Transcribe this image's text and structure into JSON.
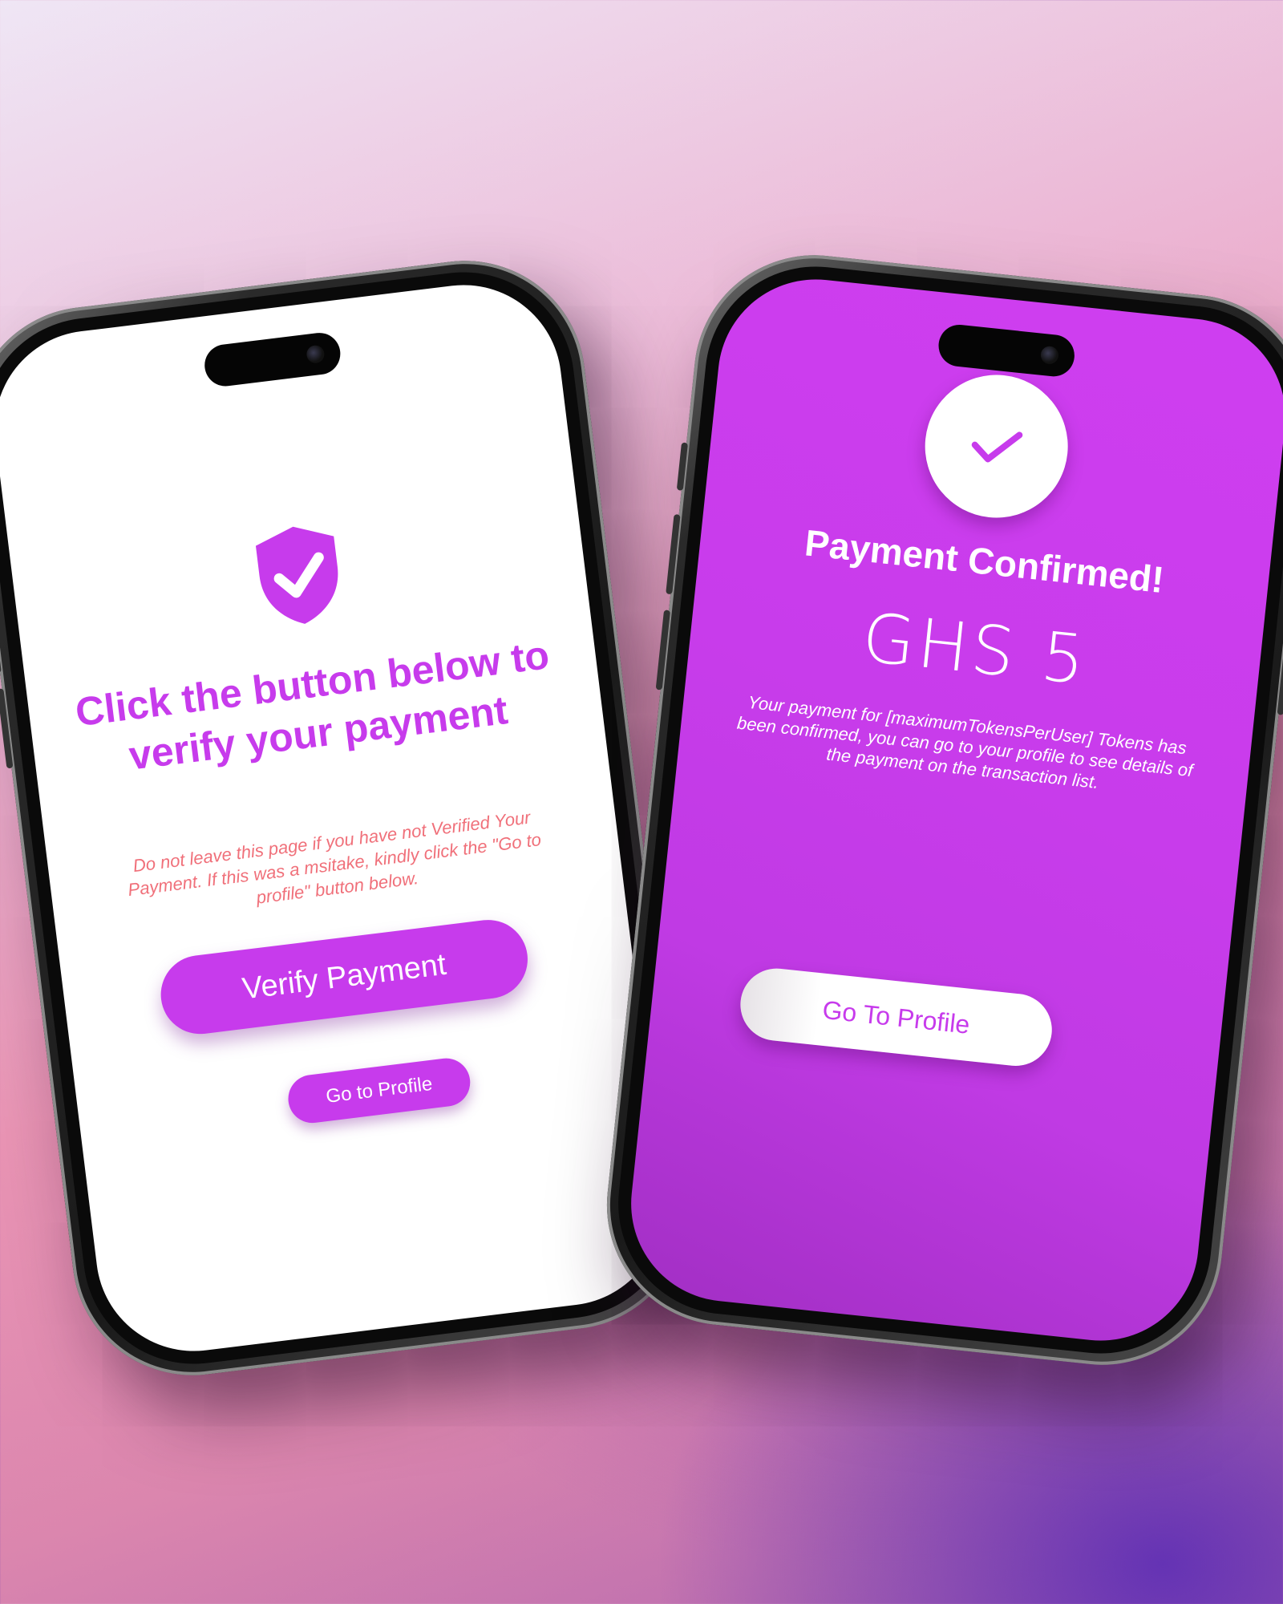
{
  "colors": {
    "accent": "#c73bec",
    "warning_text": "#f0707a",
    "screen_right_bg": "#c83ceb",
    "screen_left_bg": "#ffffff"
  },
  "verify_screen": {
    "icon": "shield-check-icon",
    "title": "Click the button below to verify your payment",
    "warning": "Do not leave this page if you have not Verified Your Payment.  If this was a msitake, kindly click the \"Go to profile\" button below.",
    "verify_button_label": "Verify Payment",
    "profile_button_label": "Go to Profile"
  },
  "confirmed_screen": {
    "icon": "checkmark-icon",
    "title": "Payment Confirmed!",
    "amount": "GHS 5",
    "message": "Your payment for [maximumTokensPerUser] Tokens has been confirmed, you can go to your profile to see details of the payment on the transaction list.",
    "profile_button_label": "Go To Profile"
  }
}
